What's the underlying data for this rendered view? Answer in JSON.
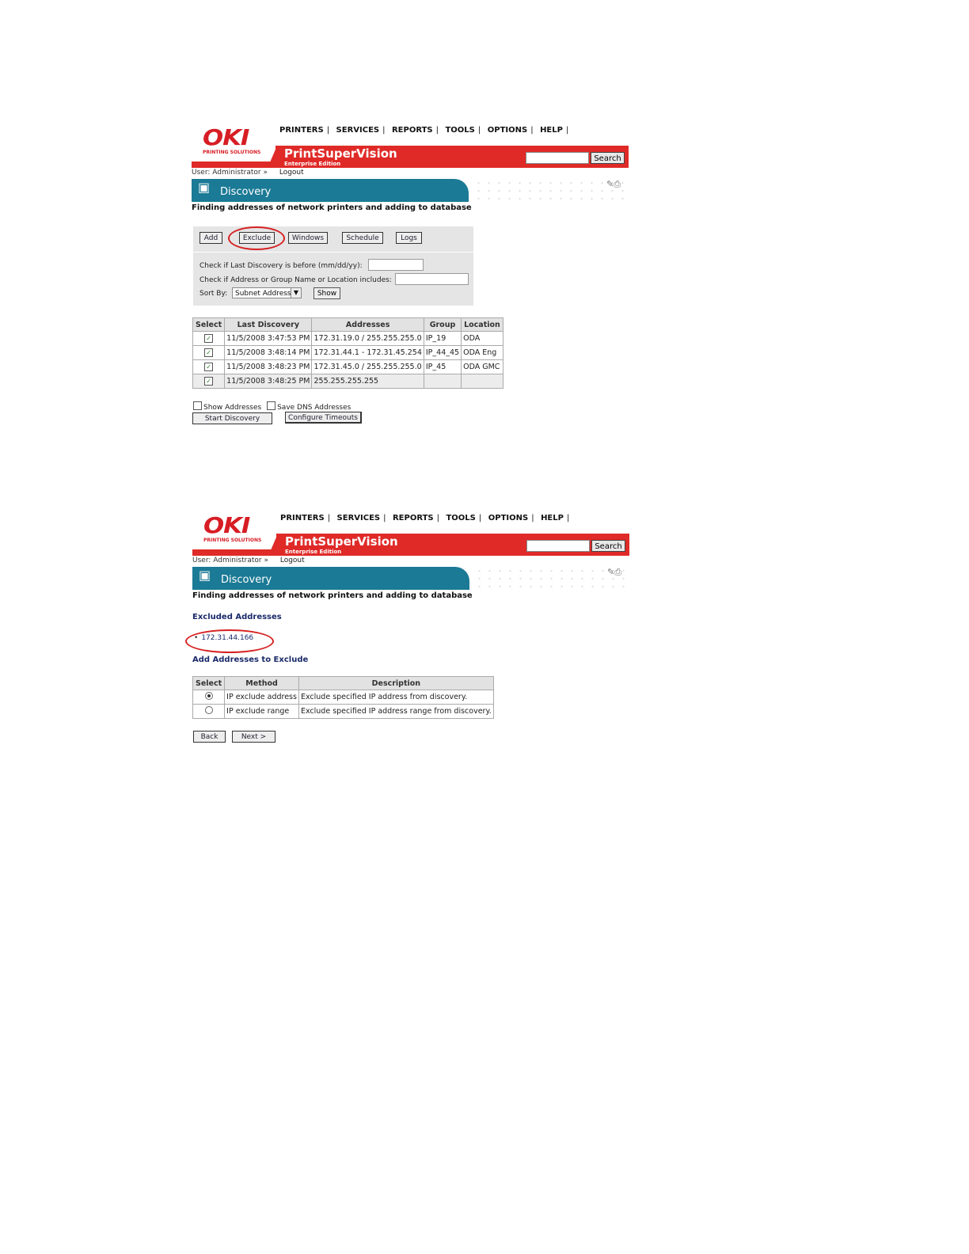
{
  "header": {
    "logo": "OKI",
    "logo_sub": "PRINTING SOLUTIONS",
    "nav": [
      "PRINTERS",
      "SERVICES",
      "REPORTS",
      "TOOLS",
      "OPTIONS",
      "HELP"
    ],
    "nav_sep": "|",
    "app_title": "PrintSuperVision",
    "app_edition": "Enterprise Edition",
    "search_label": "Search",
    "user_text": "User: Administrator »",
    "logout": "Logout",
    "page_title": "Discovery",
    "subtitle": "Finding addresses of network printers and adding to database"
  },
  "screen1": {
    "buttons": [
      "Add",
      "Exclude",
      "Windows",
      "Schedule",
      "Logs"
    ],
    "filter_date_label": "Check if Last Discovery is before (mm/dd/yy):",
    "filter_address_label": "Check if Address or Group Name or Location includes:",
    "sort_label": "Sort By:",
    "sort_value": "Subnet Address",
    "show_label": "Show",
    "table": {
      "headers": [
        "Select",
        "Last Discovery",
        "Addresses",
        "Group",
        "Location"
      ],
      "rows": [
        {
          "checked": "✓",
          "last": "11/5/2008 3:47:53 PM",
          "address": "172.31.19.0 / 255.255.255.0",
          "group": "IP_19",
          "location": "ODA"
        },
        {
          "checked": "✓",
          "last": "11/5/2008 3:48:14 PM",
          "address": "172.31.44.1 - 172.31.45.254",
          "group": "IP_44_45",
          "location": "ODA Eng"
        },
        {
          "checked": "✓",
          "last": "11/5/2008 3:48:23 PM",
          "address": "172.31.45.0 / 255.255.255.0",
          "group": "IP_45",
          "location": "ODA GMC"
        },
        {
          "checked": "✓",
          "last": "11/5/2008 3:48:25 PM",
          "address": "255.255.255.255",
          "group": "",
          "location": ""
        }
      ]
    },
    "show_addresses": "Show Addresses",
    "save_dns": "Save DNS Addresses",
    "start_discovery": "Start Discovery",
    "configure_timeouts": "Configure Timeouts"
  },
  "screen2": {
    "excluded_title": "Excluded Addresses",
    "excluded_bullet": "•",
    "excluded_items": [
      "172.31.44.166"
    ],
    "add_title": "Add Addresses to Exclude",
    "table": {
      "headers": [
        "Select",
        "Method",
        "Description"
      ],
      "rows": [
        {
          "selected": true,
          "method": "IP exclude address",
          "description": "Exclude specified IP address from discovery."
        },
        {
          "selected": false,
          "method": "IP exclude range",
          "description": "Exclude specified IP address range from discovery."
        }
      ]
    },
    "back": "Back",
    "next": "Next >"
  },
  "colors": {
    "brand_red": "#df2a27",
    "teal": "#1b7a95",
    "highlight_circle": "#d62020"
  },
  "icons": [
    "discovery-icon",
    "help-icon",
    "print-icon",
    "checkbox-icon",
    "radio-icon",
    "dropdown-arrow-icon"
  ]
}
